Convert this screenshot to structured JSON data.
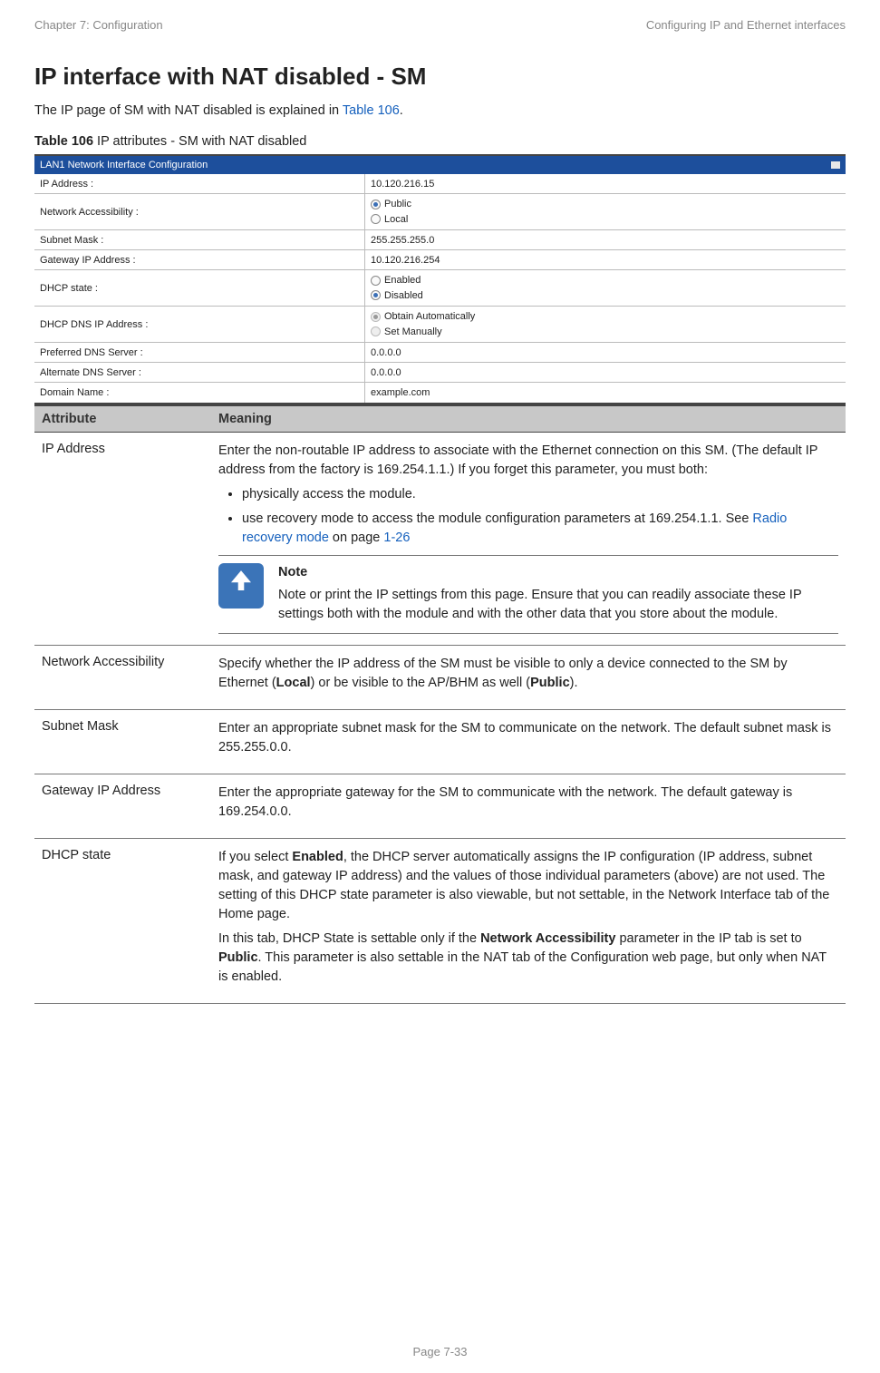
{
  "header": {
    "left": "Chapter 7:  Configuration",
    "right": "Configuring IP and Ethernet interfaces"
  },
  "title": "IP interface with NAT disabled - SM",
  "intro_pre": "The IP page of SM with NAT disabled is explained in ",
  "intro_link": "Table 106",
  "intro_post": ".",
  "caption_bold": "Table 106",
  "caption_rest": " IP attributes - SM with NAT disabled",
  "panel_title": "LAN1 Network Interface Configuration",
  "cfg": {
    "ip_label": "IP Address :",
    "ip_value": "10.120.216.15",
    "na_label": "Network Accessibility :",
    "na_opt1": "Public",
    "na_opt2": "Local",
    "subnet_label": "Subnet Mask :",
    "subnet_value": "255.255.255.0",
    "gw_label": "Gateway IP Address :",
    "gw_value": "10.120.216.254",
    "dhcp_label": "DHCP state :",
    "dhcp_opt1": "Enabled",
    "dhcp_opt2": "Disabled",
    "dns_label": "DHCP DNS IP Address :",
    "dns_opt1": "Obtain Automatically",
    "dns_opt2": "Set Manually",
    "pdns_label": "Preferred DNS Server :",
    "pdns_value": "0.0.0.0",
    "adns_label": "Alternate DNS Server :",
    "adns_value": "0.0.0.0",
    "domain_label": "Domain Name :",
    "domain_value": "example.com"
  },
  "th_attr": "Attribute",
  "th_mean": "Meaning",
  "rows": {
    "r1_attr": "IP Address",
    "r1_p1": "Enter the non-routable IP address to associate with the Ethernet connection on this SM. (The default IP address from the factory is 169.254.1.1.) If you forget this parameter, you must both:",
    "r1_li1": "physically access the module.",
    "r1_li2_pre": "use recovery mode to access the module configuration parameters at 169.254.1.1. See ",
    "r1_li2_link1": "Radio recovery mode",
    "r1_li2_mid": " on page ",
    "r1_li2_link2": "1-26",
    "r1_note_title": "Note",
    "r1_note_body": "Note or print the IP settings from this page. Ensure that you can readily associate these IP settings both with the module and with the other data that you store about the module.",
    "r2_attr": "Network Accessibility",
    "r2_p_pre": "Specify whether the IP address of the SM must be visible to only a device connected to the SM by Ethernet (",
    "r2_p_b1": "Local",
    "r2_p_mid": ") or be visible to the AP/BHM as well (",
    "r2_p_b2": "Public",
    "r2_p_post": ").",
    "r3_attr": "Subnet Mask",
    "r3_p": "Enter an appropriate subnet mask for the SM to communicate on the network. The default subnet mask is 255.255.0.0.",
    "r4_attr": "Gateway IP Address",
    "r4_p": "Enter the appropriate gateway for the SM to communicate with the network. The default gateway is 169.254.0.0.",
    "r5_attr": "DHCP state",
    "r5_p1_pre": "If you select ",
    "r5_p1_b": "Enabled",
    "r5_p1_post": ", the DHCP server automatically assigns the IP configuration (IP address, subnet mask, and gateway IP address) and the values of those individual parameters (above) are not used. The setting of this DHCP state parameter is also viewable, but not settable, in the Network Interface tab of the Home page.",
    "r5_p2_pre": "In this tab, DHCP State is settable only if the ",
    "r5_p2_b1": "Network Accessibility",
    "r5_p2_mid": " parameter in the IP tab is set to ",
    "r5_p2_b2": "Public",
    "r5_p2_post": ". This parameter is also settable in the NAT tab of the Configuration web page, but only when NAT is enabled."
  },
  "footer": "Page 7-33"
}
